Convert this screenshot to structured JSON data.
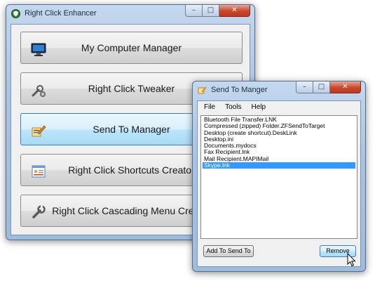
{
  "main_window": {
    "title": "Right Click Enhancer",
    "controls": {
      "minimize": "–",
      "maximize": "□",
      "close": "✕"
    },
    "buttons": [
      {
        "label": "My Computer Manager",
        "icon": "monitor-icon"
      },
      {
        "label": "Right Click Tweaker",
        "icon": "wrench-gear-icon"
      },
      {
        "label": "Send To Manager",
        "icon": "sendto-pencil-icon"
      },
      {
        "label": "Right Click Shortcuts Creator",
        "icon": "shortcut-card-icon"
      },
      {
        "label": "Right Click Cascading Menu Creator",
        "icon": "wrench-icon"
      }
    ]
  },
  "sendto_window": {
    "title": "Send To Manger",
    "controls": {
      "minimize": "–",
      "maximize": "□",
      "close": "✕"
    },
    "menu": [
      "File",
      "Tools",
      "Help"
    ],
    "items": [
      "Bluetooth File Transfer.LNK",
      "Compressed (zipped) Folder.ZFSendToTarget",
      "Desktop (create shortcut).DeskLink",
      "Desktop.ini",
      "Documents.mydocs",
      "Fax Recipient.lnk",
      "Mail Recipient.MAPIMail",
      "Skype.lnk"
    ],
    "selected_item": "Skype.lnk",
    "add_button": "Add To Send To",
    "remove_button": "Remove"
  },
  "colors": {
    "selection": "#3399ff",
    "focus_border": "#3c7fb1",
    "close_red": "#c9472d",
    "frame_blue": "#a9c3e2"
  }
}
